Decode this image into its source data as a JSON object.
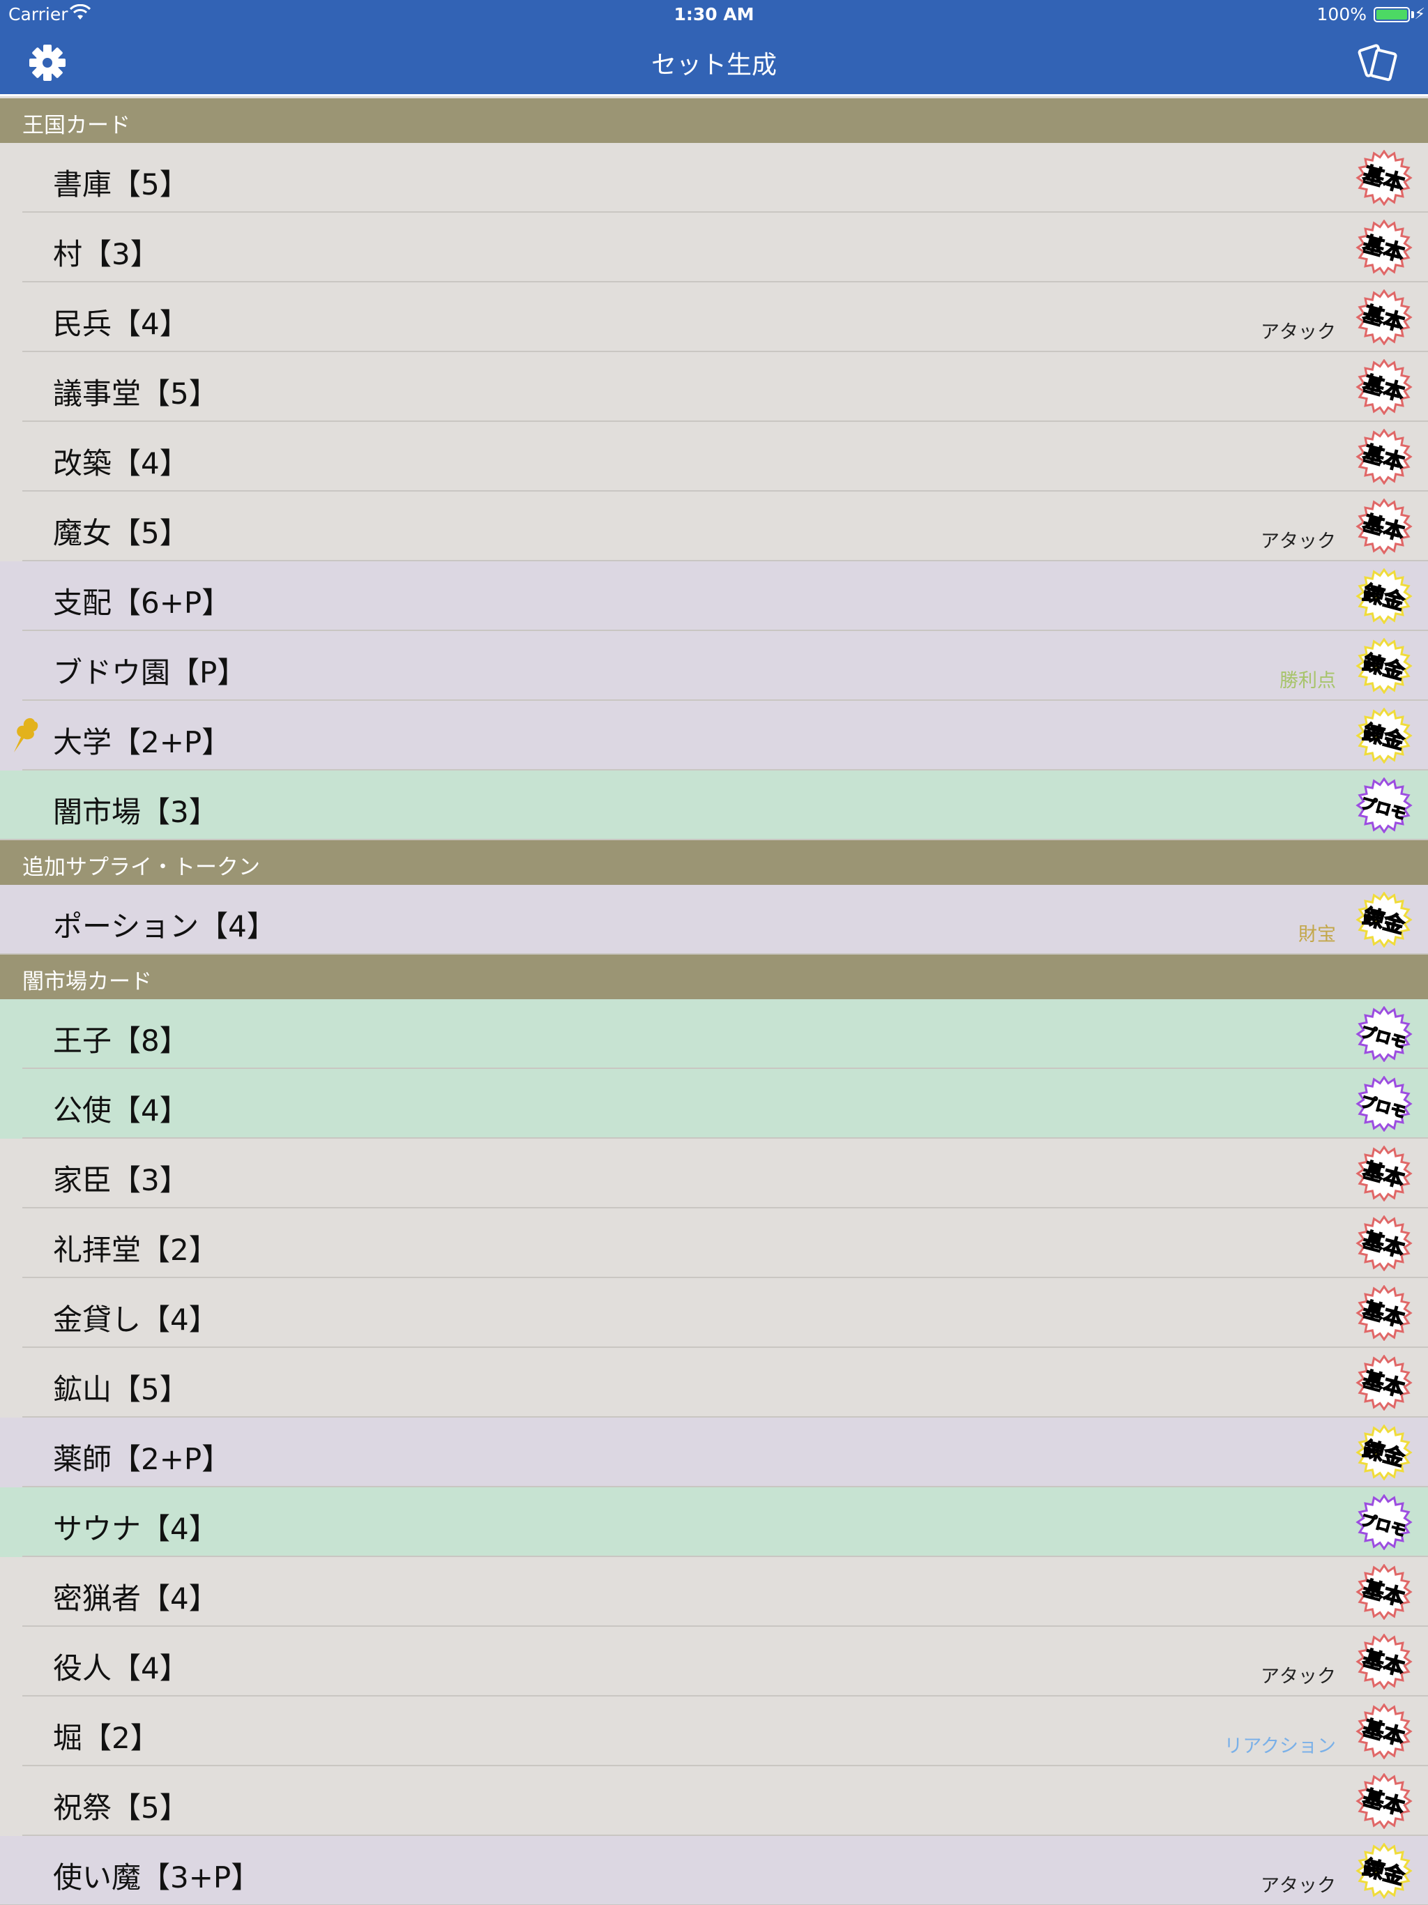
{
  "status": {
    "carrier": "Carrier",
    "time": "1:30 AM",
    "battery": "100%"
  },
  "nav": {
    "title": "セット生成"
  },
  "colors": {
    "nav": "#3263b5",
    "section": "#9b9574",
    "base": "#e1dedb",
    "alchemy": "#dcd7e2",
    "promo": "#c7e3d2"
  },
  "badges": {
    "base": "基本",
    "alchemy": "錬金",
    "promo": "プロモ"
  },
  "sections": [
    {
      "title": "王国カード",
      "rows": [
        {
          "name": "書庫【5】",
          "set": "base",
          "tag": "",
          "tag_kind": ""
        },
        {
          "name": "村【3】",
          "set": "base",
          "tag": "",
          "tag_kind": ""
        },
        {
          "name": "民兵【4】",
          "set": "base",
          "tag": "アタック",
          "tag_kind": "attack"
        },
        {
          "name": "議事堂【5】",
          "set": "base",
          "tag": "",
          "tag_kind": ""
        },
        {
          "name": "改築【4】",
          "set": "base",
          "tag": "",
          "tag_kind": ""
        },
        {
          "name": "魔女【5】",
          "set": "base",
          "tag": "アタック",
          "tag_kind": "attack"
        },
        {
          "name": "支配【6+P】",
          "set": "alchemy",
          "tag": "",
          "tag_kind": ""
        },
        {
          "name": "ブドウ園【P】",
          "set": "alchemy",
          "tag": "勝利点",
          "tag_kind": "victory"
        },
        {
          "name": "大学【2+P】",
          "set": "alchemy",
          "tag": "",
          "tag_kind": "",
          "leaf": true
        },
        {
          "name": "闇市場【3】",
          "set": "promo",
          "tag": "",
          "tag_kind": ""
        }
      ]
    },
    {
      "title": "追加サプライ・トークン",
      "rows": [
        {
          "name": "ポーション【4】",
          "set": "alchemy",
          "tag": "財宝",
          "tag_kind": "treasure"
        }
      ]
    },
    {
      "title": "闇市場カード",
      "rows": [
        {
          "name": "王子【8】",
          "set": "promo",
          "tag": "",
          "tag_kind": ""
        },
        {
          "name": "公使【4】",
          "set": "promo",
          "tag": "",
          "tag_kind": ""
        },
        {
          "name": "家臣【3】",
          "set": "base",
          "tag": "",
          "tag_kind": ""
        },
        {
          "name": "礼拝堂【2】",
          "set": "base",
          "tag": "",
          "tag_kind": ""
        },
        {
          "name": "金貸し【4】",
          "set": "base",
          "tag": "",
          "tag_kind": ""
        },
        {
          "name": "鉱山【5】",
          "set": "base",
          "tag": "",
          "tag_kind": ""
        },
        {
          "name": "薬師【2+P】",
          "set": "alchemy",
          "tag": "",
          "tag_kind": ""
        },
        {
          "name": "サウナ【4】",
          "set": "promo",
          "tag": "",
          "tag_kind": ""
        },
        {
          "name": "密猟者【4】",
          "set": "base",
          "tag": "",
          "tag_kind": ""
        },
        {
          "name": "役人【4】",
          "set": "base",
          "tag": "アタック",
          "tag_kind": "attack"
        },
        {
          "name": "堀【2】",
          "set": "base",
          "tag": "リアクション",
          "tag_kind": "reaction"
        },
        {
          "name": "祝祭【5】",
          "set": "base",
          "tag": "",
          "tag_kind": ""
        },
        {
          "name": "使い魔【3+P】",
          "set": "alchemy",
          "tag": "アタック",
          "tag_kind": "attack"
        }
      ]
    }
  ]
}
